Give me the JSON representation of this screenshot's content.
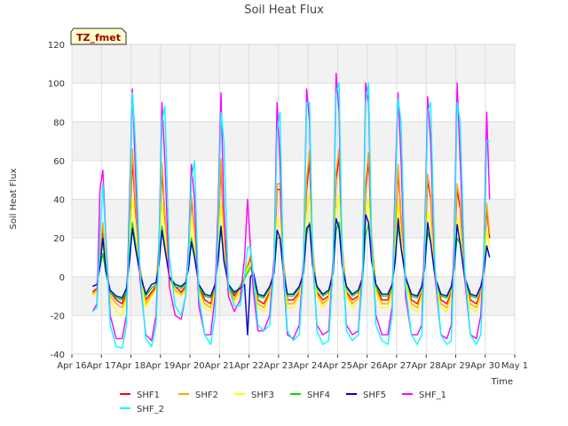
{
  "chart_data": {
    "type": "line",
    "title": "Soil Heat Flux",
    "xlabel": "Time",
    "ylabel": "Soil Heat Flux",
    "annotation": "TZ_fmet",
    "ylim": [
      -40,
      120
    ],
    "yticks": [
      -40,
      -20,
      0,
      20,
      40,
      60,
      80,
      100,
      120
    ],
    "xlim": [
      0,
      15
    ],
    "xticks": [
      0,
      1,
      2,
      3,
      4,
      5,
      6,
      7,
      8,
      9,
      10,
      11,
      12,
      13,
      14,
      15
    ],
    "xticklabels": [
      "Apr 16",
      "Apr 17",
      "Apr 18",
      "Apr 19",
      "Apr 20",
      "Apr 21",
      "Apr 22",
      "Apr 23",
      "Apr 24",
      "Apr 25",
      "Apr 26",
      "Apr 27",
      "Apr 28",
      "Apr 29",
      "Apr 30",
      "May 1"
    ],
    "grid": true,
    "legend_position": "bottom",
    "x_note": "x values are days after Apr 16 00:00",
    "x": [
      0.7,
      0.85,
      0.95,
      1.05,
      1.15,
      1.3,
      1.5,
      1.7,
      1.85,
      1.95,
      2.05,
      2.15,
      2.3,
      2.5,
      2.7,
      2.85,
      2.95,
      3.05,
      3.15,
      3.3,
      3.5,
      3.7,
      3.85,
      3.95,
      4.05,
      4.15,
      4.3,
      4.5,
      4.7,
      4.85,
      4.95,
      5.05,
      5.15,
      5.3,
      5.5,
      5.7,
      5.85,
      5.95,
      6.05,
      6.15,
      6.3,
      6.5,
      6.7,
      6.85,
      6.95,
      7.05,
      7.15,
      7.3,
      7.5,
      7.7,
      7.85,
      7.95,
      8.05,
      8.15,
      8.3,
      8.5,
      8.7,
      8.85,
      8.95,
      9.05,
      9.15,
      9.3,
      9.5,
      9.7,
      9.85,
      9.95,
      10.05,
      10.15,
      10.3,
      10.5,
      10.7,
      10.85,
      10.95,
      11.05,
      11.15,
      11.3,
      11.5,
      11.7,
      11.85,
      11.95,
      12.05,
      12.15,
      12.3,
      12.5,
      12.7,
      12.85,
      12.95,
      13.05,
      13.15,
      13.3,
      13.5,
      13.7,
      13.85,
      13.95,
      14.05,
      14.15
    ],
    "series": [
      {
        "name": "SHF1",
        "color": "#ff0000",
        "values": [
          -8,
          -6,
          10,
          25,
          5,
          -8,
          -12,
          -14,
          -8,
          20,
          60,
          35,
          5,
          -12,
          -8,
          -5,
          15,
          55,
          30,
          0,
          -5,
          -8,
          -5,
          10,
          40,
          25,
          -5,
          -12,
          -14,
          -5,
          20,
          58,
          20,
          -5,
          -10,
          -5,
          0,
          5,
          10,
          0,
          -12,
          -14,
          -8,
          5,
          45,
          45,
          10,
          -12,
          -12,
          -8,
          5,
          45,
          60,
          15,
          -8,
          -12,
          -10,
          5,
          50,
          62,
          15,
          -8,
          -12,
          -10,
          0,
          45,
          60,
          20,
          -5,
          -12,
          -12,
          -5,
          20,
          55,
          30,
          0,
          -12,
          -14,
          -8,
          10,
          50,
          40,
          0,
          -12,
          -14,
          -8,
          10,
          45,
          35,
          0,
          -12,
          -14,
          -8,
          5,
          35,
          20
        ]
      },
      {
        "name": "SHF2",
        "color": "#ffa500",
        "values": [
          -9,
          -7,
          12,
          28,
          6,
          -10,
          -14,
          -16,
          -10,
          22,
          66,
          38,
          6,
          -14,
          -9,
          -6,
          17,
          59,
          32,
          0,
          -7,
          -9,
          -6,
          11,
          42,
          26,
          -6,
          -14,
          -16,
          -6,
          22,
          61,
          22,
          -6,
          -12,
          -6,
          0,
          6,
          11,
          0,
          -14,
          -16,
          -9,
          6,
          48,
          48,
          11,
          -14,
          -14,
          -9,
          6,
          50,
          65,
          17,
          -9,
          -14,
          -11,
          6,
          54,
          66,
          17,
          -9,
          -14,
          -11,
          0,
          49,
          64,
          22,
          -6,
          -14,
          -14,
          -6,
          22,
          58,
          32,
          0,
          -14,
          -16,
          -9,
          11,
          53,
          42,
          0,
          -14,
          -16,
          -9,
          11,
          48,
          38,
          0,
          -14,
          -16,
          -9,
          6,
          38,
          22
        ]
      },
      {
        "name": "SHF3",
        "color": "#ffff00",
        "values": [
          -10,
          -8,
          8,
          18,
          4,
          -12,
          -18,
          -20,
          -12,
          14,
          40,
          28,
          3,
          -16,
          -10,
          -7,
          12,
          38,
          24,
          -2,
          -8,
          -10,
          -7,
          8,
          30,
          18,
          -8,
          -16,
          -18,
          -8,
          15,
          38,
          15,
          -8,
          -14,
          -8,
          -2,
          4,
          7,
          -2,
          -16,
          -18,
          -10,
          4,
          30,
          30,
          7,
          -16,
          -16,
          -10,
          4,
          33,
          42,
          12,
          -10,
          -16,
          -12,
          4,
          35,
          42,
          12,
          -10,
          -16,
          -12,
          -2,
          32,
          40,
          15,
          -8,
          -16,
          -16,
          -8,
          15,
          38,
          22,
          -2,
          -16,
          -18,
          -10,
          7,
          34,
          28,
          -2,
          -16,
          -18,
          -10,
          7,
          30,
          25,
          -2,
          -16,
          -18,
          -10,
          4,
          24,
          15
        ]
      },
      {
        "name": "SHF4",
        "color": "#00dd00",
        "values": [
          -5,
          -4,
          5,
          12,
          2,
          -8,
          -11,
          -12,
          -8,
          10,
          28,
          18,
          2,
          -10,
          -6,
          -4,
          8,
          26,
          16,
          -1,
          -5,
          -6,
          -4,
          5,
          20,
          12,
          -5,
          -10,
          -11,
          -5,
          10,
          26,
          10,
          -5,
          -9,
          -5,
          -1,
          2,
          5,
          -1,
          -10,
          -11,
          -6,
          2,
          20,
          20,
          5,
          -10,
          -10,
          -6,
          2,
          22,
          28,
          8,
          -6,
          -10,
          -8,
          2,
          24,
          28,
          8,
          -6,
          -10,
          -8,
          -1,
          22,
          27,
          10,
          -5,
          -10,
          -10,
          -5,
          10,
          26,
          15,
          -1,
          -10,
          -11,
          -6,
          5,
          23,
          18,
          -1,
          -10,
          -11,
          -6,
          5,
          20,
          17,
          -1,
          -10,
          -11,
          -6,
          2,
          16,
          10
        ]
      },
      {
        "name": "SHF5",
        "color": "#0000cc",
        "values": [
          -5,
          -4,
          5,
          20,
          3,
          -7,
          -10,
          -11,
          -6,
          8,
          25,
          15,
          2,
          -9,
          -4,
          -3,
          6,
          24,
          14,
          0,
          -4,
          -5,
          -3,
          4,
          18,
          10,
          -4,
          -9,
          -10,
          -4,
          8,
          26,
          8,
          -4,
          -8,
          -6,
          -4,
          -30,
          0,
          2,
          -9,
          -10,
          -5,
          2,
          24,
          20,
          4,
          -9,
          -9,
          -5,
          2,
          25,
          27,
          6,
          -5,
          -9,
          -7,
          2,
          30,
          25,
          6,
          -5,
          -9,
          -7,
          0,
          32,
          28,
          8,
          -4,
          -9,
          -9,
          -4,
          8,
          30,
          15,
          0,
          -9,
          -10,
          -5,
          4,
          28,
          18,
          0,
          -9,
          -10,
          -5,
          4,
          27,
          17,
          0,
          -9,
          -10,
          -5,
          2,
          16,
          10
        ]
      },
      {
        "name": "SHF_1",
        "color": "#ff00ff",
        "values": [
          -18,
          -14,
          45,
          55,
          20,
          -20,
          -32,
          -32,
          -20,
          40,
          97,
          55,
          0,
          -30,
          -33,
          -20,
          15,
          90,
          60,
          -5,
          -20,
          -22,
          -10,
          15,
          58,
          40,
          -15,
          -30,
          -30,
          -10,
          35,
          95,
          35,
          -10,
          -18,
          -12,
          10,
          40,
          15,
          -8,
          -28,
          -28,
          -20,
          10,
          90,
          60,
          5,
          -30,
          -32,
          -25,
          10,
          97,
          80,
          10,
          -25,
          -30,
          -28,
          10,
          105,
          85,
          10,
          -25,
          -30,
          -28,
          5,
          100,
          90,
          15,
          -20,
          -30,
          -30,
          -15,
          50,
          95,
          60,
          -10,
          -30,
          -30,
          -25,
          20,
          93,
          70,
          0,
          -30,
          -32,
          -25,
          20,
          100,
          60,
          0,
          -30,
          -32,
          -20,
          10,
          85,
          40
        ]
      },
      {
        "name": "SHF_2",
        "color": "#00ffff",
        "values": [
          -18,
          -16,
          20,
          48,
          18,
          -25,
          -36,
          -37,
          -25,
          30,
          95,
          70,
          5,
          -32,
          -36,
          -25,
          10,
          80,
          88,
          10,
          -15,
          -20,
          -10,
          10,
          50,
          60,
          -10,
          -30,
          -35,
          -20,
          25,
          85,
          70,
          -5,
          -15,
          -15,
          0,
          15,
          15,
          0,
          -25,
          -28,
          -25,
          5,
          75,
          85,
          10,
          -28,
          -33,
          -30,
          5,
          90,
          90,
          15,
          -28,
          -35,
          -33,
          5,
          95,
          100,
          15,
          -28,
          -33,
          -30,
          0,
          90,
          100,
          20,
          -25,
          -33,
          -35,
          -20,
          40,
          92,
          80,
          -5,
          -30,
          -35,
          -30,
          10,
          85,
          90,
          5,
          -30,
          -35,
          -33,
          10,
          90,
          80,
          5,
          -30,
          -35,
          -30,
          5,
          70,
          70
        ]
      }
    ]
  }
}
